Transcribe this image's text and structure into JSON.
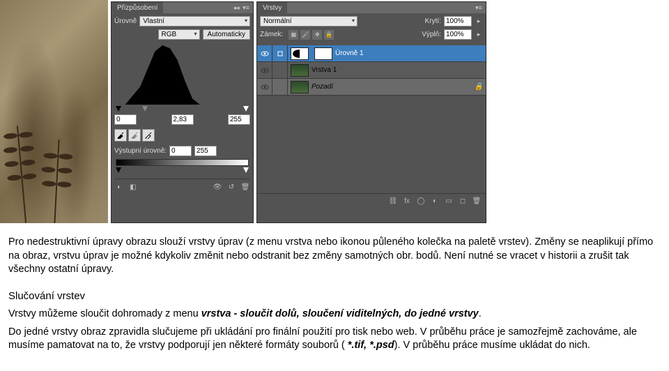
{
  "levels_panel": {
    "tab_title": "Přizpůsobení",
    "preset_label": "Úrovně",
    "preset_value": "Vlastní",
    "channel_value": "RGB",
    "auto_button": "Automaticky",
    "input_black": "0",
    "input_gamma": "2,83",
    "input_white": "255",
    "output_label": "Výstupní úrovně:",
    "output_black": "0",
    "output_white": "255"
  },
  "layers_panel": {
    "tab_title": "Vrstvy",
    "blend_mode": "Normální",
    "opacity_label": "Krytí:",
    "opacity_value": "100%",
    "lock_label": "Zámek:",
    "fill_label": "Výplň:",
    "fill_value": "100%",
    "layers": [
      {
        "name": "Úrovně 1",
        "type": "adjustment"
      },
      {
        "name": "Vrstva 1",
        "type": "normal"
      },
      {
        "name": "Pozadí",
        "type": "background"
      }
    ]
  },
  "document": {
    "p1": "Pro nedestruktivní úpravy obrazu slouží vrstvy úprav (z menu vrstva nebo ikonou půleného kolečka na paletě vrstev). Změny se neaplikují přímo na obraz, vrstvu úprav je možné kdykoliv změnit nebo odstranit bez změny samotných obr. bodů. Není nutné se vracet v historii a zrušit tak všechny ostatní úpravy.",
    "section_title": "Slučování vrstev",
    "p2a": "Vrstvy můžeme sloučit dohromady z menu ",
    "p2b": "vrstva - sloučit dolů, sloučení viditelných, do jedné vrstvy",
    "p2c": ".",
    "p3a": "Do jedné vrstvy obraz zpravidla slučujeme při ukládání pro finální použití pro tisk nebo web. V průběhu práce je samozřejmě zachováme, ale musíme pamatovat na to, že vrstvy podporují jen některé formáty souborů ( ",
    "p3b": "*.tif, *.psd",
    "p3c": "). V průběhu práce musíme ukládat do nich."
  }
}
